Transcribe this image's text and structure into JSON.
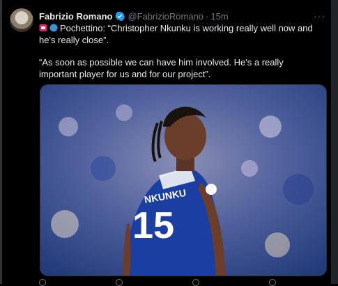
{
  "tweet": {
    "author_name": "Fabrizio Romano",
    "handle": "@FabrizioRomano",
    "separator": "·",
    "time": "15m",
    "more": "···",
    "text_line1": "Pochettino: “Christopher Nkunku is working really well now and he's really close”.",
    "text_line2": "“As soon as possible we can have him involved. He's a really important player for us and for our project”."
  },
  "photo": {
    "shirt_name": "NKUNKU",
    "shirt_number": "15",
    "shirt_color": "#1b3ea3"
  },
  "icons": {
    "verified": "verified-badge-icon",
    "flag": "red-flag-icon",
    "dot": "blue-circle-icon"
  },
  "colors": {
    "accent": "#1d9bf0",
    "text": "#e7e9ea",
    "muted": "#71767b",
    "background": "#000000"
  }
}
